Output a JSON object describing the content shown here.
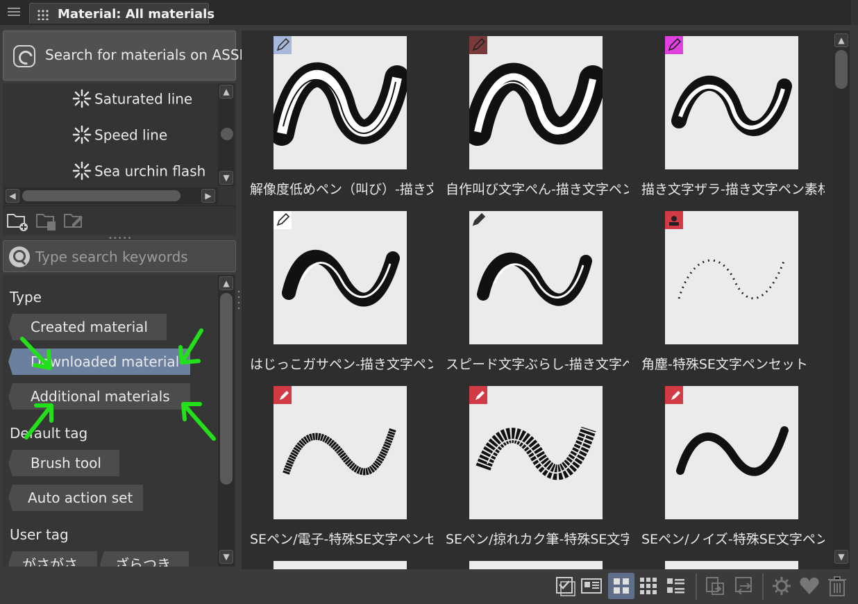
{
  "window": {
    "tab_title": "Material: All materials"
  },
  "assets_button": {
    "label": "Search for materials on ASSETS"
  },
  "tree": {
    "items": [
      {
        "label": "Saturated line"
      },
      {
        "label": "Speed line"
      },
      {
        "label": "Sea urchin flash"
      }
    ]
  },
  "search": {
    "placeholder": "Type search keywords",
    "value": ""
  },
  "filters": {
    "type_heading": "Type",
    "type_tags": [
      {
        "label": "Created material",
        "selected": false
      },
      {
        "label": "Downloaded material",
        "selected": true
      },
      {
        "label": "Additional materials",
        "selected": false
      }
    ],
    "default_heading": "Default tag",
    "default_tags": [
      {
        "label": "Brush tool"
      },
      {
        "label": "Auto action set"
      }
    ],
    "user_heading": "User tag",
    "user_tags": [
      {
        "label": "がさがさ"
      },
      {
        "label": "ざらつき"
      }
    ],
    "annotation_color": "#22e01a"
  },
  "materials": [
    {
      "caption": "解像度低めペン（叫び）-描き文字ペン素材集",
      "badge": "pen-icon",
      "badge_color": "#a8b8dc"
    },
    {
      "caption": "自作叫び文字ぺん-描き文字ペン素材集",
      "badge": "pen-icon",
      "badge_color": "#7a3a3a"
    },
    {
      "caption": "描き文字ザラ-描き文字ペン素材集",
      "badge": "pen-icon",
      "badge_color": "#e040e0"
    },
    {
      "caption": "はじっこガサペン-描き文字ペン素材集",
      "badge": "pen-icon",
      "badge_color": "#ffffff"
    },
    {
      "caption": "スピード文字ぶらし-描き文字ペン素材集",
      "badge": "pen-icon",
      "badge_color": "#ebebeb"
    },
    {
      "caption": "角塵-特殊SE文字ペンセット",
      "badge": "stamp-icon",
      "badge_color": "#d23a46"
    },
    {
      "caption": "SEペン/電子-特殊SE文字ペンセット",
      "badge": "se-pen-icon",
      "badge_color": "#d23a46"
    },
    {
      "caption": "SEペン/掠れカク筆-特殊SE文字ペンセット",
      "badge": "se-pen-icon",
      "badge_color": "#d23a46"
    },
    {
      "caption": "SEペン/ノイズ-特殊SE文字ペンセット",
      "badge": "se-pen-icon",
      "badge_color": "#d23a46"
    }
  ],
  "accent_color": "#6b7f9e"
}
